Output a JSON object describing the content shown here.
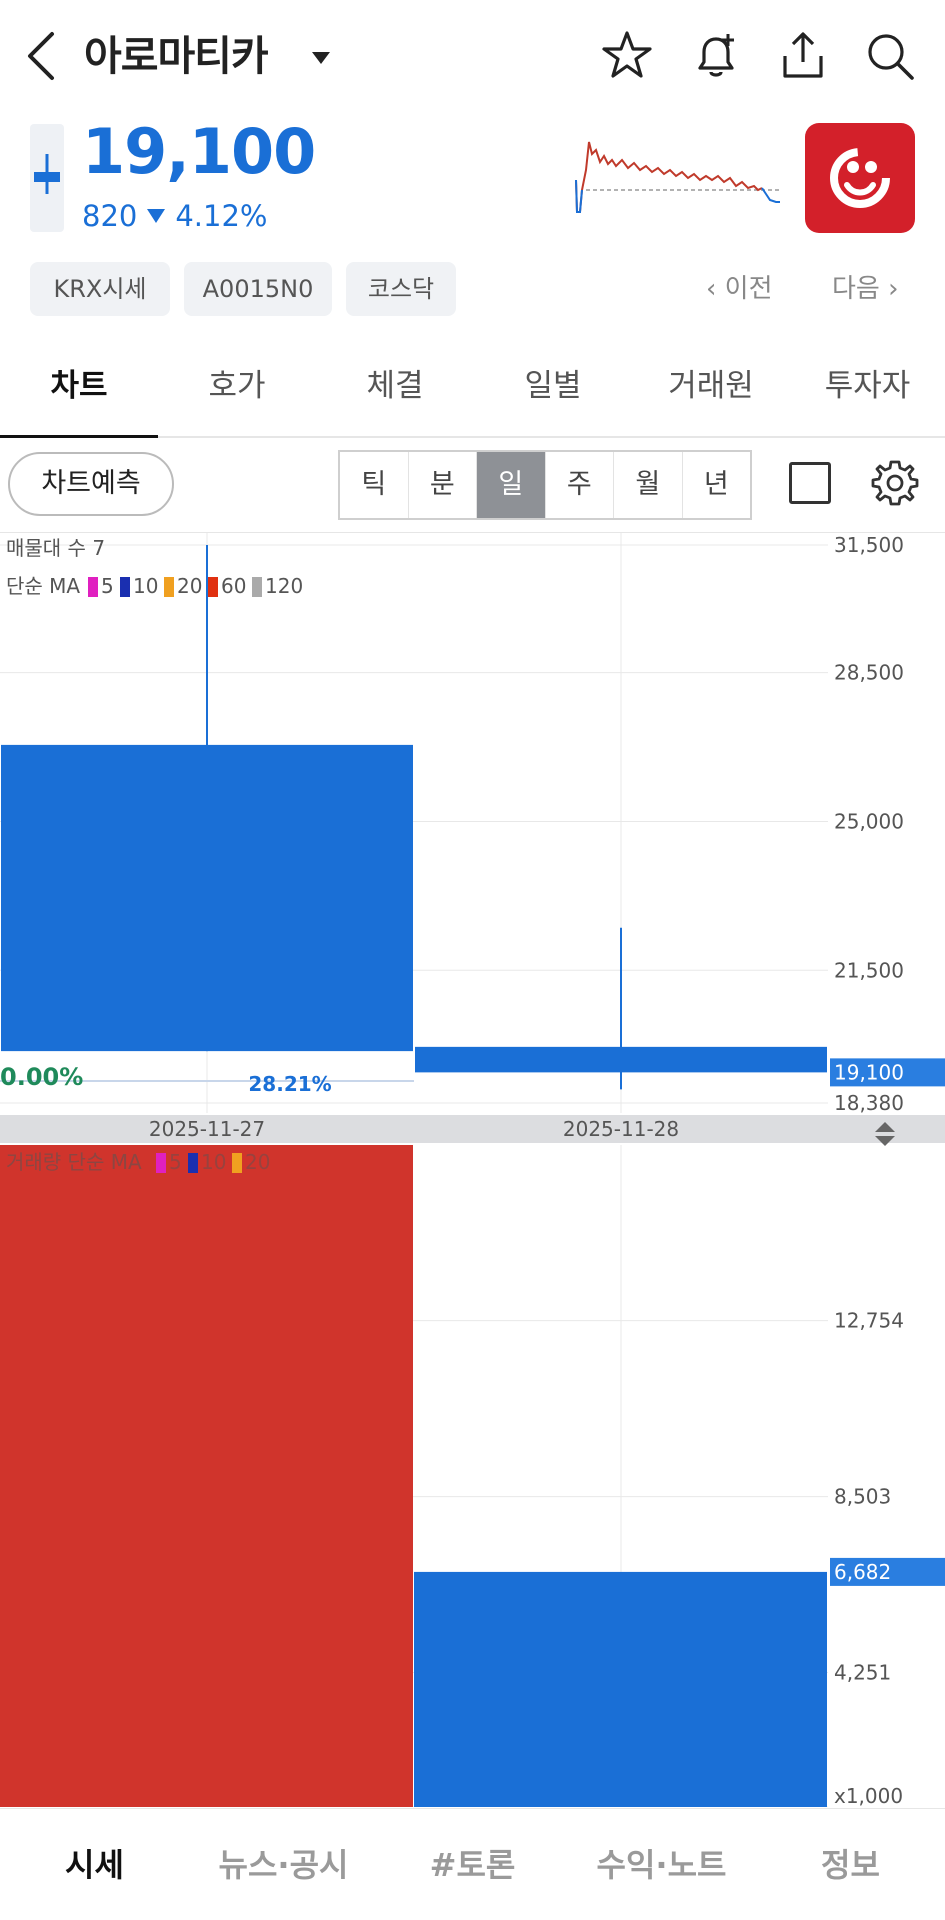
{
  "header": {
    "title": "아로마티카",
    "icons": [
      "back-arrow-icon",
      "dropdown-caret-icon",
      "star-icon",
      "bell-plus-icon",
      "share-icon",
      "search-icon"
    ]
  },
  "quote": {
    "price": "19,100",
    "change": "820",
    "change_rate": "4.12%",
    "direction": "down",
    "color": "#1a6fd6"
  },
  "chips": [
    "KRX시세",
    "A0015N0",
    "코스닥"
  ],
  "nav": {
    "prev": "이전",
    "next": "다음"
  },
  "tabs": [
    {
      "label": "차트",
      "active": true
    },
    {
      "label": "호가",
      "active": false
    },
    {
      "label": "체결",
      "active": false
    },
    {
      "label": "일별",
      "active": false
    },
    {
      "label": "거래원",
      "active": false
    },
    {
      "label": "투자자",
      "active": false
    }
  ],
  "toolbar": {
    "predict_label": "차트예측",
    "periods": [
      "틱",
      "분",
      "일",
      "주",
      "월",
      "년"
    ],
    "active_period": "일"
  },
  "legend": {
    "volume_profile": "매물대 수 7",
    "ma_prefix": "단순 MA",
    "ma_items": [
      {
        "label": "5",
        "color": "#e020c0"
      },
      {
        "label": "10",
        "color": "#1a2fb0"
      },
      {
        "label": "20",
        "color": "#f0a020"
      },
      {
        "label": "60",
        "color": "#e03010"
      },
      {
        "label": "120",
        "color": "#aaaaaa"
      }
    ],
    "volume_ma_label": "거래량 단순 MA",
    "volume_ma_items": [
      {
        "label": "5",
        "color": "#e020c0"
      },
      {
        "label": "10",
        "color": "#1a2fb0"
      },
      {
        "label": "20",
        "color": "#f0a020"
      }
    ]
  },
  "chart_data": [
    {
      "type": "candlestick",
      "categories": [
        "2025-11-27",
        "2025-11-28"
      ],
      "candles": [
        {
          "date": "2025-11-27",
          "open": 26800,
          "close": 19600,
          "high": 31500,
          "low": 19600,
          "color": "#1a6fd6"
        },
        {
          "date": "2025-11-28",
          "open": 19700,
          "close": 19100,
          "high": 22500,
          "low": 18700,
          "color": "#1a6fd6"
        }
      ],
      "ylim": [
        18380,
        31500
      ],
      "y_ticks": [
        "31,500",
        "28,500",
        "25,000",
        "21,500",
        "18,380"
      ],
      "current_price": "19,100",
      "annotations": [
        "0.00%",
        "28.21%"
      ]
    },
    {
      "type": "bar",
      "title": "",
      "categories": [
        "2025-11-27",
        "2025-11-28"
      ],
      "values": [
        19000,
        6682
      ],
      "colors": [
        "#d0342c",
        "#1a6fd6"
      ],
      "ylim": [
        1000,
        17000
      ],
      "y_ticks": [
        "12,754",
        "8,503",
        "4,251",
        "x1,000"
      ],
      "current_value": "6,682"
    }
  ],
  "bottom_nav": [
    {
      "label": "시세",
      "active": true
    },
    {
      "label": "뉴스·공시",
      "active": false
    },
    {
      "label": "#토론",
      "active": false
    },
    {
      "label": "수익·노트",
      "active": false
    },
    {
      "label": "정보",
      "active": false
    }
  ]
}
